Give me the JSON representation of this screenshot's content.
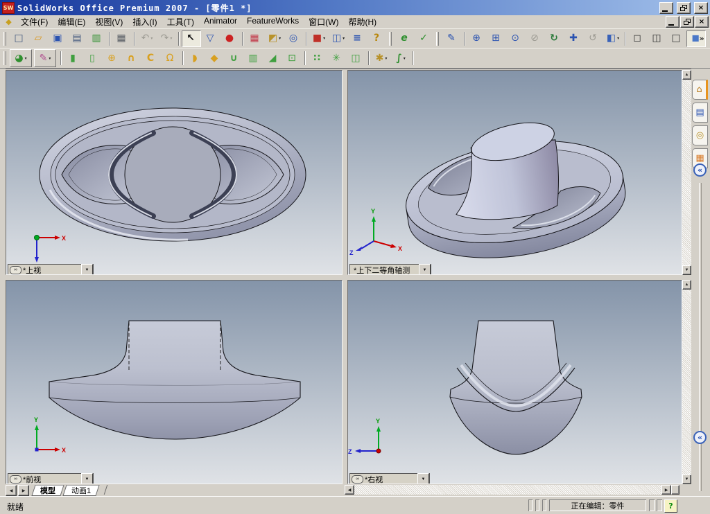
{
  "window": {
    "logo": "SW",
    "title": "SolidWorks Office Premium 2007 - [零件1 *]",
    "min": "—",
    "close": "×"
  },
  "menu": {
    "doc_icon": "◆",
    "items": [
      {
        "name": "menu-file",
        "label": "文件(F)"
      },
      {
        "name": "menu-edit",
        "label": "编辑(E)"
      },
      {
        "name": "menu-view",
        "label": "视图(V)"
      },
      {
        "name": "menu-insert",
        "label": "插入(I)"
      },
      {
        "name": "menu-tools",
        "label": "工具(T)"
      },
      {
        "name": "menu-animator",
        "label": "Animator"
      },
      {
        "name": "menu-featureworks",
        "label": "FeatureWorks"
      },
      {
        "name": "menu-window",
        "label": "窗口(W)"
      },
      {
        "name": "menu-help",
        "label": "帮助(H)"
      }
    ]
  },
  "toolbar_main": {
    "items": [
      {
        "cls": "titem tgrip",
        "name": "toolbar-grip",
        "inter": "false",
        "g": "",
        "dd": "",
        "css": ""
      },
      {
        "cls": "titem tbtn",
        "name": "new-button",
        "inter": "true",
        "g": "□",
        "dd": "",
        "css": "color:#44597e"
      },
      {
        "cls": "titem tbtn",
        "name": "open-button",
        "inter": "true",
        "g": "▱",
        "dd": "",
        "css": "color:#d9971e"
      },
      {
        "cls": "titem tbtn",
        "name": "save-button",
        "inter": "true",
        "g": "▣",
        "dd": "",
        "css": "color:#2a52b0"
      },
      {
        "cls": "titem tbtn",
        "name": "make-drawing-button",
        "inter": "true",
        "g": "▤",
        "dd": "",
        "css": "color:#44597e"
      },
      {
        "cls": "titem tbtn",
        "name": "make-assembly-button",
        "inter": "true",
        "g": "▥",
        "dd": "",
        "css": "color:#2f8f2f"
      },
      {
        "cls": "titem tsep",
        "name": "toolbar-separator",
        "inter": "false",
        "g": "",
        "dd": "",
        "css": ""
      },
      {
        "cls": "titem tbtn",
        "name": "print-button",
        "inter": "true",
        "g": "▦",
        "dd": "",
        "css": "color:#5a5f66"
      },
      {
        "cls": "titem tsep",
        "name": "toolbar-separator",
        "inter": "false",
        "g": "",
        "dd": "",
        "css": ""
      },
      {
        "cls": "titem tbtn disabled",
        "name": "undo-button",
        "inter": "true",
        "g": "↶",
        "dd": "▾",
        "css": "color:#9c9a92"
      },
      {
        "cls": "titem tbtn disabled",
        "name": "redo-button",
        "inter": "true",
        "g": "↷",
        "dd": "▾",
        "css": "color:#9c9a92"
      },
      {
        "cls": "titem tsep",
        "name": "toolbar-separator",
        "inter": "false",
        "g": "",
        "dd": "",
        "css": ""
      },
      {
        "cls": "titem tbtn pressed",
        "name": "select-button",
        "inter": "true",
        "g": "↖",
        "dd": "",
        "css": "color:#111;font-weight:bold"
      },
      {
        "cls": "titem tbtn",
        "name": "selection-filter-button",
        "inter": "true",
        "g": "▽",
        "dd": "",
        "css": "color:#2a52b0"
      },
      {
        "cls": "titem tbtn",
        "name": "toggle-selection-filter-button",
        "inter": "true",
        "g": "●",
        "dd": "",
        "css": "color:#cc2222"
      },
      {
        "cls": "titem tsep",
        "name": "toolbar-separator",
        "inter": "false",
        "g": "",
        "dd": "",
        "css": ""
      },
      {
        "cls": "titem tbtn",
        "name": "edit-color-button",
        "inter": "true",
        "g": "▦",
        "dd": "",
        "css": "color:#c23a4a"
      },
      {
        "cls": "titem tbtn",
        "name": "measure-button",
        "inter": "true",
        "g": "◩",
        "dd": "▾",
        "css": "color:#b8922a"
      },
      {
        "cls": "titem tbtn",
        "name": "check-button",
        "inter": "true",
        "g": "◎",
        "dd": "",
        "css": "color:#2a52b0"
      },
      {
        "cls": "titem tsep",
        "name": "toolbar-separator",
        "inter": "false",
        "g": "",
        "dd": "",
        "css": ""
      },
      {
        "cls": "titem tbtn",
        "name": "solidworks-content-button",
        "inter": "true",
        "g": "■",
        "dd": "▾",
        "css": "color:#c03028"
      },
      {
        "cls": "titem tbtn",
        "name": "viewport-layout-button",
        "inter": "true",
        "g": "◫",
        "dd": "▾",
        "css": "color:#2a52b0"
      },
      {
        "cls": "titem tbtn",
        "name": "options-list-button",
        "inter": "true",
        "g": "≡",
        "dd": "",
        "css": "color:#2a52b0;font-weight:bold"
      },
      {
        "cls": "titem tbtn",
        "name": "help-button",
        "inter": "true",
        "g": "?",
        "dd": "",
        "css": "color:#b8860b;font-weight:bold"
      },
      {
        "cls": "titem tgrip",
        "name": "toolbar-grip",
        "inter": "false",
        "g": "",
        "dd": "",
        "css": ""
      },
      {
        "cls": "titem tbtn",
        "name": "edrawings-button",
        "inter": "true",
        "g": "e",
        "dd": "",
        "css": "color:#2f8f2f;font-weight:bold;font-style:italic"
      },
      {
        "cls": "titem tbtn",
        "name": "featureworks-check-button",
        "inter": "true",
        "g": "✓",
        "dd": "",
        "css": "color:#2f8f2f;font-weight:bold"
      },
      {
        "cls": "titem tgrip",
        "name": "toolbar-grip",
        "inter": "false",
        "g": "",
        "dd": "",
        "css": ""
      },
      {
        "cls": "titem tbtn",
        "name": "redraw-button",
        "inter": "true",
        "g": "✎",
        "dd": "",
        "css": "color:#2a52b0"
      },
      {
        "cls": "titem tsep",
        "name": "toolbar-separator",
        "inter": "false",
        "g": "",
        "dd": "",
        "css": ""
      },
      {
        "cls": "titem tbtn",
        "name": "zoom-fit-button",
        "inter": "true",
        "g": "⊕",
        "dd": "",
        "css": "color:#2a52b0"
      },
      {
        "cls": "titem tbtn",
        "name": "zoom-area-button",
        "inter": "true",
        "g": "⊞",
        "dd": "",
        "css": "color:#2a52b0"
      },
      {
        "cls": "titem tbtn",
        "name": "zoom-in-out-button",
        "inter": "true",
        "g": "⊙",
        "dd": "",
        "css": "color:#2a52b0"
      },
      {
        "cls": "titem tbtn disabled",
        "name": "zoom-selection-button",
        "inter": "true",
        "g": "⊘",
        "dd": "",
        "css": "color:#9c9a92"
      },
      {
        "cls": "titem tbtn",
        "name": "rotate-view-button",
        "inter": "true",
        "g": "↻",
        "dd": "",
        "css": "color:#2a7a3a;font-weight:bold"
      },
      {
        "cls": "titem tbtn",
        "name": "pan-button",
        "inter": "true",
        "g": "✚",
        "dd": "",
        "css": "color:#2a52b0"
      },
      {
        "cls": "titem tbtn disabled",
        "name": "rotate-about-button",
        "inter": "true",
        "g": "↺",
        "dd": "",
        "css": "color:#9c9a92"
      },
      {
        "cls": "titem tbtn",
        "name": "standard-views-button",
        "inter": "true",
        "g": "◧",
        "dd": "▾",
        "css": "color:#3a62b8"
      },
      {
        "cls": "titem tsep",
        "name": "toolbar-separator",
        "inter": "false",
        "g": "",
        "dd": "",
        "css": ""
      },
      {
        "cls": "titem tbtn",
        "name": "wireframe-button",
        "inter": "true",
        "g": "◻",
        "dd": "",
        "css": "color:#333"
      },
      {
        "cls": "titem tbtn",
        "name": "hidden-lines-visible-button",
        "inter": "true",
        "g": "◫",
        "dd": "",
        "css": "color:#333"
      },
      {
        "cls": "titem tbtn",
        "name": "hidden-lines-removed-button",
        "inter": "true",
        "g": "□",
        "dd": "",
        "css": "color:#333"
      },
      {
        "cls": "titem tbtn pressed",
        "name": "shaded-with-edges-button",
        "inter": "true",
        "g": "◼",
        "dd": "",
        "css": "color:#4a78c8"
      },
      {
        "cls": "titem tbtn",
        "name": "shaded-button",
        "inter": "true",
        "g": "■",
        "dd": "",
        "css": "color:#7aa0dc"
      },
      {
        "cls": "titem tsep",
        "name": "toolbar-separator",
        "inter": "false",
        "g": "",
        "dd": "",
        "css": ""
      },
      {
        "cls": "titem tbtn",
        "name": "shadows-button",
        "inter": "true",
        "g": "▣",
        "dd": "",
        "css": "color:#4a78c8"
      }
    ]
  },
  "toolbar_features": {
    "items": [
      {
        "cls": "titem tgrip",
        "name": "toolbar-grip",
        "inter": "false",
        "g": "",
        "dd": "",
        "css": ""
      },
      {
        "cls": "titem tbtn grouped",
        "name": "active-feature-button",
        "inter": "true",
        "g": "◕",
        "dd": "▾",
        "css": "color:#2f8f2f"
      },
      {
        "cls": "titem tbtn grouped",
        "name": "sketch-button",
        "inter": "true",
        "g": "✎",
        "dd": "▾",
        "css": "color:#b05090"
      },
      {
        "cls": "titem tsep",
        "name": "toolbar-separator",
        "inter": "false",
        "g": "",
        "dd": "",
        "css": ""
      },
      {
        "cls": "titem tbtn",
        "name": "extruded-boss-button",
        "inter": "true",
        "g": "▮",
        "dd": "",
        "css": "color:#3f9f3f"
      },
      {
        "cls": "titem tbtn",
        "name": "extruded-cut-button",
        "inter": "true",
        "g": "▯",
        "dd": "",
        "css": "color:#3f9f3f"
      },
      {
        "cls": "titem tbtn",
        "name": "revolved-boss-button",
        "inter": "true",
        "g": "⊕",
        "dd": "",
        "css": "color:#d8a020"
      },
      {
        "cls": "titem tbtn",
        "name": "revolved-cut-button",
        "inter": "true",
        "g": "∩",
        "dd": "",
        "css": "color:#d8a020;font-weight:bold"
      },
      {
        "cls": "titem tbtn",
        "name": "swept-boss-button",
        "inter": "true",
        "g": "C",
        "dd": "",
        "css": "color:#d8a020;font-weight:bold"
      },
      {
        "cls": "titem tbtn",
        "name": "lofted-boss-button",
        "inter": "true",
        "g": "Ω",
        "dd": "",
        "css": "color:#d8a020"
      },
      {
        "cls": "titem tsep",
        "name": "toolbar-separator",
        "inter": "false",
        "g": "",
        "dd": "",
        "css": ""
      },
      {
        "cls": "titem tbtn",
        "name": "fillet-button",
        "inter": "true",
        "g": "◗",
        "dd": "",
        "css": "color:#d8a020"
      },
      {
        "cls": "titem tbtn",
        "name": "chamfer-button",
        "inter": "true",
        "g": "◆",
        "dd": "",
        "css": "color:#d8a020"
      },
      {
        "cls": "titem tbtn",
        "name": "shell-button",
        "inter": "true",
        "g": "∪",
        "dd": "",
        "css": "color:#3f9f3f;font-weight:bold"
      },
      {
        "cls": "titem tbtn",
        "name": "rib-button",
        "inter": "true",
        "g": "▥",
        "dd": "",
        "css": "color:#3f9f3f"
      },
      {
        "cls": "titem tbtn",
        "name": "draft-button",
        "inter": "true",
        "g": "◢",
        "dd": "",
        "css": "color:#3f9f3f"
      },
      {
        "cls": "titem tbtn",
        "name": "hole-wizard-button",
        "inter": "true",
        "g": "⊡",
        "dd": "",
        "css": "color:#3f9f3f"
      },
      {
        "cls": "titem tsep",
        "name": "toolbar-separator",
        "inter": "false",
        "g": "",
        "dd": "",
        "css": ""
      },
      {
        "cls": "titem tbtn",
        "name": "linear-pattern-button",
        "inter": "true",
        "g": "∷",
        "dd": "",
        "css": "color:#3f9f3f;font-weight:bold"
      },
      {
        "cls": "titem tbtn",
        "name": "circular-pattern-button",
        "inter": "true",
        "g": "✳",
        "dd": "",
        "css": "color:#3f9f3f"
      },
      {
        "cls": "titem tbtn",
        "name": "mirror-button",
        "inter": "true",
        "g": "◫",
        "dd": "",
        "css": "color:#3f9f3f"
      },
      {
        "cls": "titem tsep",
        "name": "toolbar-separator",
        "inter": "false",
        "g": "",
        "dd": "",
        "css": ""
      },
      {
        "cls": "titem tbtn",
        "name": "reference-geometry-button",
        "inter": "true",
        "g": "✱",
        "dd": "▾",
        "css": "color:#b8922a"
      },
      {
        "cls": "titem tbtn",
        "name": "curves-button",
        "inter": "true",
        "g": "∫",
        "dd": "▾",
        "css": "color:#2f8f2f;font-weight:bold"
      },
      {
        "cls": "titem tsep",
        "name": "toolbar-separator",
        "inter": "false",
        "g": "",
        "dd": "",
        "css": ""
      }
    ]
  },
  "overflow": "»",
  "combo_arrow": "▼",
  "viewports": [
    {
      "label": "*上视",
      "link": "∞"
    },
    {
      "label": "*上下二等角轴测",
      "link": ""
    },
    {
      "label": "*前视",
      "link": "∞"
    },
    {
      "label": "*右视",
      "link": "∞"
    }
  ],
  "axes": {
    "x": "X",
    "y": "Y",
    "z": "Z"
  },
  "sheet_tabs": {
    "prev": "◀",
    "next": "▶",
    "items": [
      {
        "label": "模型",
        "cls": "sheet-tab active",
        "name": "sheet-tab-model"
      },
      {
        "label": "动画1",
        "cls": "sheet-tab",
        "name": "sheet-tab-animation1"
      }
    ]
  },
  "scrollbars": {
    "up": "▲",
    "down": "▼",
    "left": "◀",
    "right": "▶"
  },
  "taskpane": {
    "collapse": "«",
    "items": [
      {
        "cls": "tp-tab active",
        "name": "taskpane-home-tab",
        "g": "⌂",
        "css": "color:#b8791a"
      },
      {
        "cls": "tp-tab",
        "name": "taskpane-design-library-tab",
        "g": "▤",
        "css": "color:#2a52b0"
      },
      {
        "cls": "tp-tab",
        "name": "taskpane-file-explorer-tab",
        "g": "◎",
        "css": "color:#b8922a"
      },
      {
        "cls": "tp-tab",
        "name": "taskpane-view-palette-tab",
        "g": "▦",
        "css": "color:#d87b2a"
      }
    ]
  },
  "status": {
    "ready": "就绪",
    "editing": "正在编辑：零件",
    "help": "?"
  }
}
